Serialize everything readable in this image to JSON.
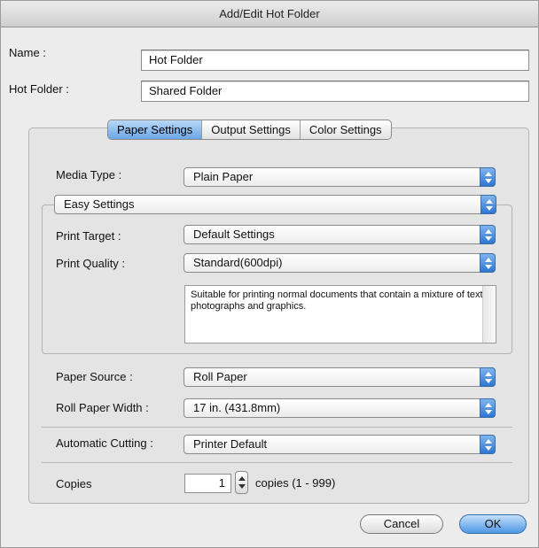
{
  "window": {
    "title": "Add/Edit Hot Folder"
  },
  "fields": {
    "name_label": "Name :",
    "name_value": "Hot Folder",
    "hot_folder_label": "Hot Folder :",
    "hot_folder_value": "Shared Folder"
  },
  "tabs": [
    {
      "label": "Paper Settings",
      "active": true
    },
    {
      "label": "Output Settings",
      "active": false
    },
    {
      "label": "Color Settings",
      "active": false
    }
  ],
  "paper": {
    "media_type_label": "Media Type :",
    "media_type_value": "Plain Paper",
    "settings_mode_value": "Easy Settings",
    "print_target_label": "Print Target :",
    "print_target_value": "Default Settings",
    "print_quality_label": "Print Quality :",
    "print_quality_value": "Standard(600dpi)",
    "description": "Suitable for printing normal documents that contain a mixture of text, photographs and graphics.",
    "paper_source_label": "Paper Source :",
    "paper_source_value": "Roll Paper",
    "roll_width_label": "Roll Paper Width :",
    "roll_width_value": "17 in. (431.8mm)",
    "auto_cut_label": "Automatic Cutting :",
    "auto_cut_value": "Printer Default",
    "copies_label": "Copies",
    "copies_value": "1",
    "copies_range": "copies (1 - 999)"
  },
  "buttons": {
    "cancel": "Cancel",
    "ok": "OK"
  },
  "colors": {
    "accent": "#4d97e6",
    "window_bg": "#ececec"
  }
}
